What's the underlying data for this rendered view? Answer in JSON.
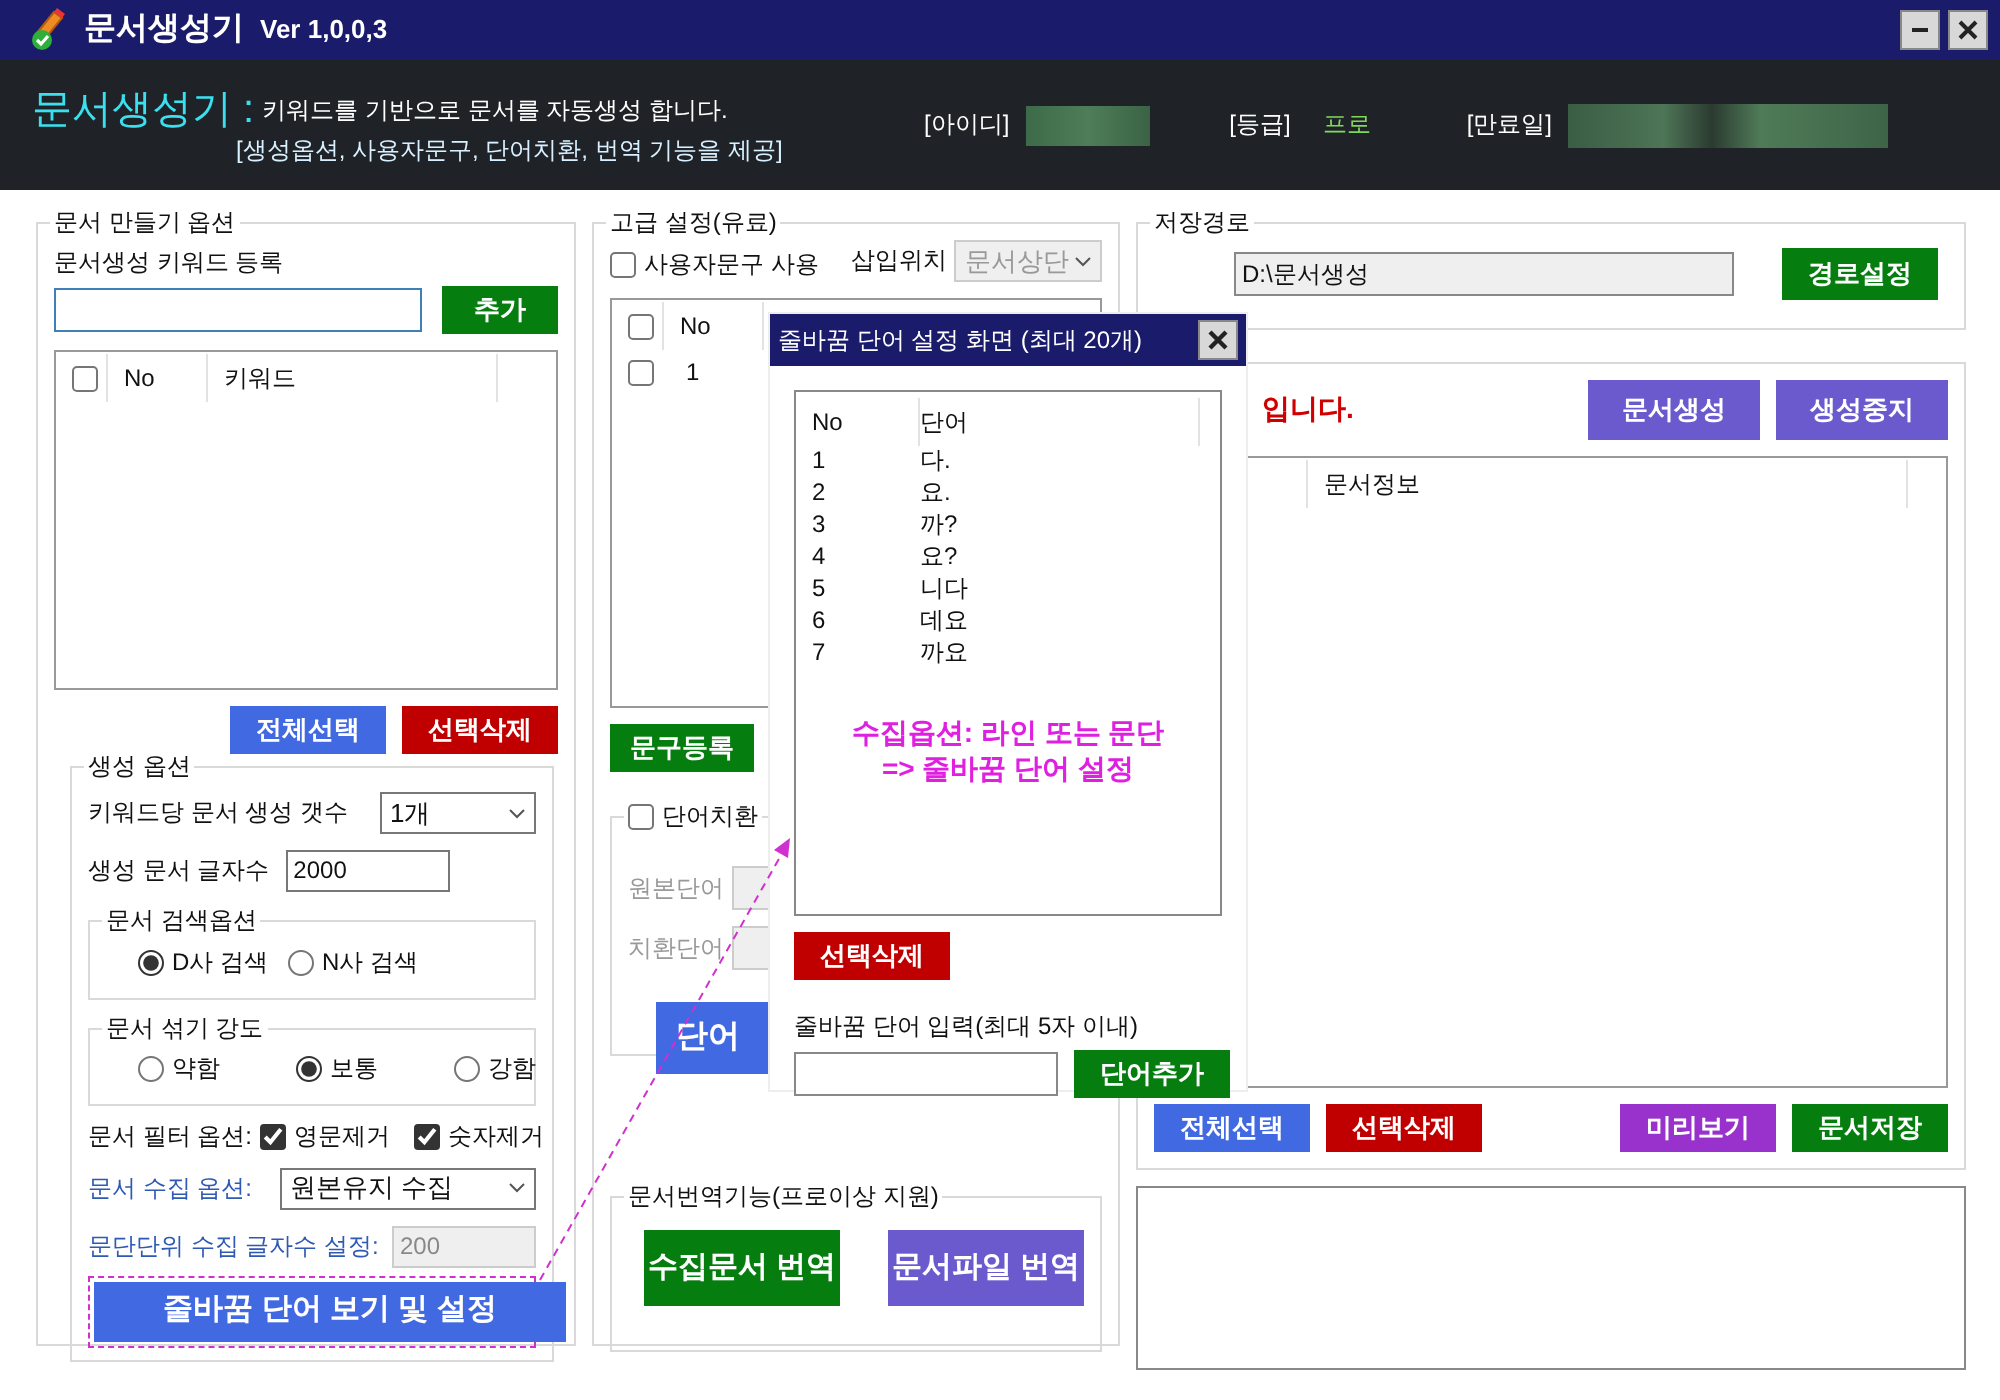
{
  "window": {
    "title": "문서생성기",
    "version": "Ver 1,0,0,3"
  },
  "banner": {
    "brand": "문서생성기 :",
    "description": "키워드를 기반으로 문서를 자동생성 합니다.",
    "features": "[생성옵션, 사용자문구, 단어치환, 번역 기능을 제공]",
    "id_label": "[아이디]",
    "grade_label": "[등급]",
    "grade": "프로",
    "expiry_label": "[만료일]"
  },
  "doc_options": {
    "title": "문서 만들기 옵션",
    "keyword_label": "문서생성 키워드 등록",
    "add_button": "추가",
    "header_checked": false,
    "columns": [
      "No",
      "키워드"
    ],
    "select_all": "전체선택",
    "delete_selected": "선택삭제"
  },
  "generation_options": {
    "title": "생성 옵션",
    "count_label": "키워드당 문서 생성 갯수",
    "count_value": "1개",
    "length_label": "생성 문서 글자수",
    "length_value": "2000",
    "search": {
      "title": "문서 검색옵션",
      "options": [
        {
          "label": "D사 검색",
          "selected": true
        },
        {
          "label": "N사 검색",
          "selected": false
        }
      ]
    },
    "mix": {
      "title": "문서 섞기 강도",
      "options": [
        {
          "label": "약함",
          "selected": false
        },
        {
          "label": "보통",
          "selected": true
        },
        {
          "label": "강함",
          "selected": false
        }
      ]
    },
    "filter_label": "문서 필터 옵션:",
    "filters": [
      {
        "label": "영문제거",
        "checked": true
      },
      {
        "label": "숫자제거",
        "checked": true
      }
    ],
    "collect_label": "문서 수집 옵션:",
    "collect_value": "원본유지 수집",
    "paragraph_label": "문단단위 수집 글자수 설정:",
    "paragraph_value": "200",
    "paragraph_disabled": true,
    "linebreak_button": "줄바꿈 단어 보기 및 설정"
  },
  "advanced": {
    "title": "고급 설정(유료)",
    "user_phrase": {
      "label": "사용자문구 사용",
      "checked": false
    },
    "position_label": "삽입위치",
    "position_value": "문서상단",
    "position_disabled": true,
    "header_checked": false,
    "columns": [
      "No"
    ],
    "rows": [
      {
        "no": "1",
        "checked": false
      }
    ],
    "register_button": "문구등록",
    "replace": {
      "label": "단어치환",
      "checked": false,
      "original_label": "원본단어",
      "replacement_label": "치환단어",
      "button": "단어"
    }
  },
  "translate": {
    "title": "문서번역기능(프로이상 지원)",
    "collected_button": "수집문서 번역",
    "file_button": "문서파일 번역"
  },
  "save_path": {
    "title": "저장경로",
    "path": "D:\\문서생성",
    "button": "경로설정"
  },
  "generate": {
    "status": "입니다.",
    "generate_button": "문서생성",
    "stop_button": "생성중지",
    "columns": [
      "문서정보"
    ],
    "select_all": "전체선택",
    "delete_selected": "선택삭제",
    "preview_button": "미리보기",
    "save_button": "문서저장"
  },
  "dialog": {
    "title": "줄바꿈 단어 설정 화면 (최대 20개)",
    "columns": [
      "No",
      "단어"
    ],
    "rows": [
      {
        "no": "1",
        "word": "다."
      },
      {
        "no": "2",
        "word": "요."
      },
      {
        "no": "3",
        "word": "까?"
      },
      {
        "no": "4",
        "word": "요?"
      },
      {
        "no": "5",
        "word": "니다"
      },
      {
        "no": "6",
        "word": "데요"
      },
      {
        "no": "7",
        "word": "까요"
      }
    ],
    "hint": [
      "수집옵션: 라인 또는 문단",
      "=> 줄바꿈 단어 설정"
    ],
    "delete_button": "선택삭제",
    "input_label": "줄바꿈 단어 입력(최대 5자 이내)",
    "add_button": "단어추가"
  }
}
